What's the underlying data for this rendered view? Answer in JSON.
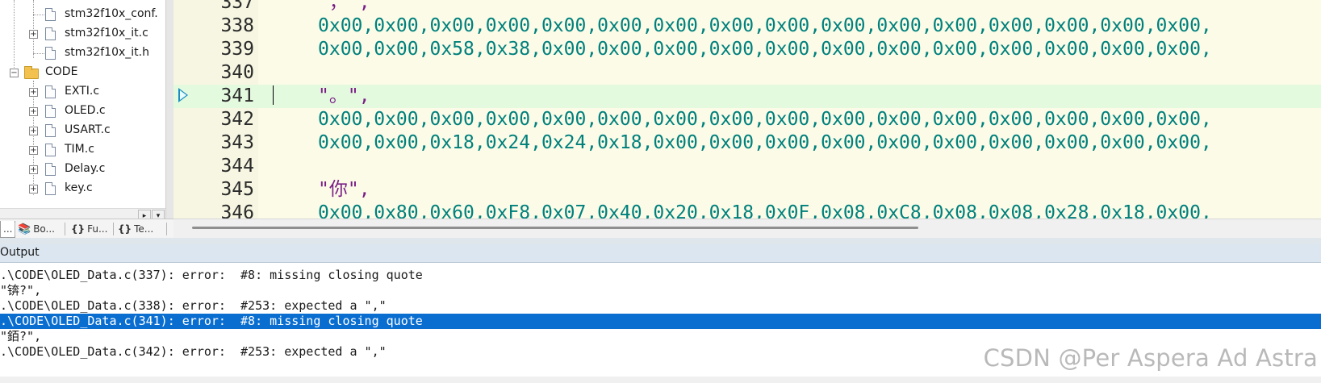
{
  "project_tree": {
    "items": [
      {
        "label": "stm32f10x_conf.",
        "type": "file",
        "expandable": false
      },
      {
        "label": "stm32f10x_it.c",
        "type": "file",
        "expandable": true
      },
      {
        "label": "stm32f10x_it.h",
        "type": "file",
        "expandable": false
      },
      {
        "label": "CODE",
        "type": "folder",
        "expandable": true
      },
      {
        "label": "EXTI.c",
        "type": "file",
        "expandable": true
      },
      {
        "label": "OLED.c",
        "type": "file",
        "expandable": true
      },
      {
        "label": "USART.c",
        "type": "file",
        "expandable": true
      },
      {
        "label": "TIM.c",
        "type": "file",
        "expandable": true
      },
      {
        "label": "Delay.c",
        "type": "file",
        "expandable": true
      },
      {
        "label": "key.c",
        "type": "file",
        "expandable": true
      }
    ],
    "expander_plus": "+",
    "expander_minus": "−",
    "scroll_right_glyph": "▸",
    "scroll_down_glyph": "▾"
  },
  "panel_tabs": [
    {
      "label": "...",
      "icon": "project-icon",
      "glyph": "",
      "active": true
    },
    {
      "label": "Bo...",
      "icon": "books-icon",
      "glyph": "📚",
      "active": false
    },
    {
      "label": "Fu...",
      "icon": "functions-icon",
      "glyph": "{}",
      "active": false
    },
    {
      "label": "Te...",
      "icon": "templates-icon",
      "glyph": "{}",
      "active": false
    }
  ],
  "editor": {
    "lines": [
      {
        "num": "337",
        "code": "\"，\",",
        "kind": "str"
      },
      {
        "num": "338",
        "code": "0x00,0x00,0x00,0x00,0x00,0x00,0x00,0x00,0x00,0x00,0x00,0x00,0x00,0x00,0x00,0x00,",
        "kind": "hex"
      },
      {
        "num": "339",
        "code": "0x00,0x00,0x58,0x38,0x00,0x00,0x00,0x00,0x00,0x00,0x00,0x00,0x00,0x00,0x00,0x00,",
        "kind": "hex"
      },
      {
        "num": "340",
        "code": "",
        "kind": "hex"
      },
      {
        "num": "341",
        "code": "\"。\",",
        "kind": "str"
      },
      {
        "num": "342",
        "code": "0x00,0x00,0x00,0x00,0x00,0x00,0x00,0x00,0x00,0x00,0x00,0x00,0x00,0x00,0x00,0x00,",
        "kind": "hex"
      },
      {
        "num": "343",
        "code": "0x00,0x00,0x18,0x24,0x24,0x18,0x00,0x00,0x00,0x00,0x00,0x00,0x00,0x00,0x00,0x00,",
        "kind": "hex"
      },
      {
        "num": "344",
        "code": "",
        "kind": "hex"
      },
      {
        "num": "345",
        "code": "\"你\",",
        "kind": "str"
      },
      {
        "num": "346",
        "code": "0x00,0x80,0x60,0xF8,0x07,0x40,0x20,0x18,0x0F,0x08,0xC8,0x08,0x08,0x28,0x18,0x00,",
        "kind": "hex"
      }
    ],
    "current_line": "341",
    "colors": {
      "hex": "#00807c",
      "string": "#7a1d86",
      "current_line_bg": "#e4fadf",
      "background": "#fbfbe8"
    }
  },
  "output": {
    "title": "Output",
    "lines": [
      ".\\CODE\\OLED_Data.c(337): error:  #8: missing closing quote",
      "\"锛?\",",
      ".\\CODE\\OLED_Data.c(338): error:  #253: expected a \",\"",
      ".\\CODE\\OLED_Data.c(341): error:  #8: missing closing quote",
      "\"銆?\",",
      ".\\CODE\\OLED_Data.c(342): error:  #253: expected a \",\""
    ],
    "selected_index": 3,
    "selection_color": "#0a6ed1"
  },
  "watermark": "CSDN @Per  Aspera Ad Astra"
}
